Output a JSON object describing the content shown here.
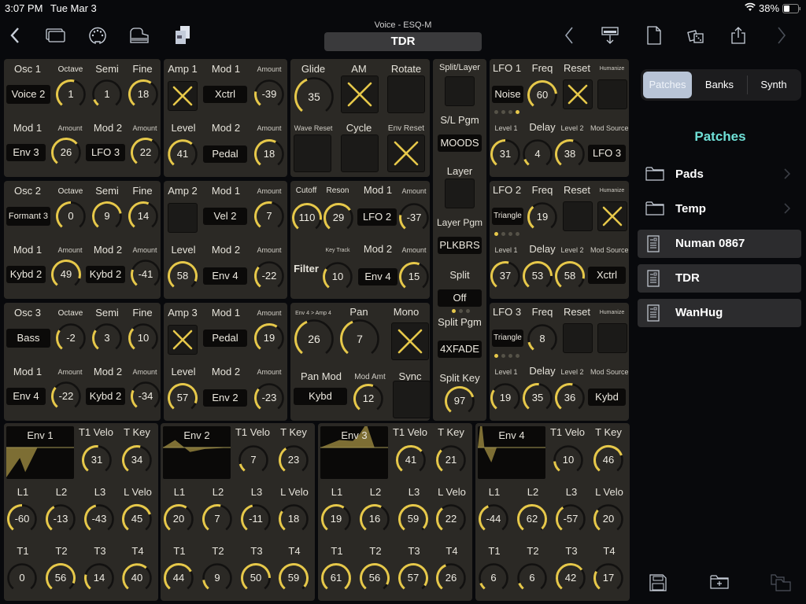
{
  "status": {
    "time": "3:07 PM",
    "date": "Tue Mar 3",
    "battery": "38%"
  },
  "toolbar": {
    "subtitle": "Voice - ESQ-M",
    "title": "TDR",
    "left_icons": [
      "back-chevron-icon",
      "windows-icon",
      "midi-din-icon",
      "piano-icon",
      "documents-icon"
    ],
    "right_icons": [
      "previous-chevron-icon",
      "keyboard-download-icon",
      "new-document-icon",
      "dice-random-icon",
      "share-icon",
      "next-chevron-icon"
    ]
  },
  "accent": "#e6c84a",
  "oscs": [
    {
      "name": "Osc 1",
      "wave": "Voice 2",
      "octave": "1",
      "semi": "1",
      "fine": "18",
      "mod1": "Env 3",
      "amt1": "26",
      "mod2": "LFO 3",
      "amt2": "22",
      "octave_f": 0.55,
      "semi_f": 0.1,
      "fine_f": 0.62,
      "amt1_f": 0.68,
      "amt2_f": 0.6
    },
    {
      "name": "Osc 2",
      "wave": "Formant 3",
      "octave": "0",
      "semi": "9",
      "fine": "14",
      "mod1": "Kybd 2",
      "amt1": "49",
      "mod2": "Kybd 2",
      "amt2": "-41",
      "octave_f": 0.5,
      "semi_f": 0.78,
      "fine_f": 0.58,
      "amt1_f": 0.88,
      "amt2_f": 0.25
    },
    {
      "name": "Osc 3",
      "wave": "Bass",
      "octave": "-2",
      "semi": "3",
      "fine": "10",
      "mod1": "Env 4",
      "amt1": "-22",
      "mod2": "Kybd 2",
      "amt2": "-34",
      "octave_f": 0.3,
      "semi_f": 0.3,
      "fine_f": 0.33,
      "amt1_f": 0.32,
      "amt2_f": 0.27
    }
  ],
  "amps": [
    {
      "name": "Amp 1",
      "on": true,
      "mod1": "Xctrl",
      "amt1": "-39",
      "level": "41",
      "mod2": "Pedal",
      "amt2": "18",
      "amt1_f": 0.22,
      "level_f": 0.65,
      "amt2_f": 0.6
    },
    {
      "name": "Amp 2",
      "on": false,
      "mod1": "Vel 2",
      "amt1": "7",
      "level": "58",
      "mod2": "Env 4",
      "amt2": "-22",
      "amt1_f": 0.54,
      "level_f": 0.9,
      "amt2_f": 0.32
    },
    {
      "name": "Amp 3",
      "on": true,
      "mod1": "Pedal",
      "amt1": "19",
      "level": "57",
      "mod2": "Env 2",
      "amt2": "-23",
      "amt1_f": 0.62,
      "level_f": 0.9,
      "amt2_f": 0.32
    }
  ],
  "labels": {
    "octave": "Octave",
    "semi": "Semi",
    "fine": "Fine",
    "mod1": "Mod 1",
    "mod2": "Mod 2",
    "amount": "Amount",
    "level": "Level",
    "glide": "Glide",
    "am": "AM",
    "rotate": "Rotate",
    "wave_reset": "Wave Reset",
    "cycle": "Cycle",
    "env_reset": "Env Reset",
    "cutoff": "Cutoff",
    "reson": "Reson",
    "key_track": "Key Track",
    "filter": "Filter",
    "env4amp4": "Env 4 > Amp 4",
    "pan": "Pan",
    "mono": "Mono",
    "pan_mod": "Pan Mod",
    "mod_amt": "Mod Amt",
    "sync": "Sync",
    "split_layer": "Split/Layer",
    "sl_pgm": "S/L Pgm",
    "layer": "Layer",
    "layer_pgm": "Layer Pgm",
    "split": "Split",
    "split_pgm": "Split Pgm",
    "split_key": "Split Key",
    "freq": "Freq",
    "reset": "Reset",
    "humanize": "Humanize",
    "level1": "Level 1",
    "delay": "Delay",
    "level2": "Level 2",
    "mod_source": "Mod Source",
    "t1velo": "T1 Velo",
    "tkey": "T Key",
    "l1": "L1",
    "l2": "L2",
    "l3": "L3",
    "lvelo": "L Velo",
    "t1": "T1",
    "t2": "T2",
    "t3": "T3",
    "t4": "T4"
  },
  "glide": {
    "glide": "35",
    "glide_f": 0.42,
    "am": true,
    "rotate": false,
    "wave_reset": false,
    "cycle": false,
    "env_reset": true
  },
  "filter": {
    "cutoff": "110",
    "reson": "29",
    "mod1": "LFO 2",
    "amt1": "-37",
    "key_track": "10",
    "mod2": "Env 4",
    "amt2": "15",
    "cutoff_f": 0.85,
    "reson_f": 0.7,
    "amt1_f": 0.22,
    "key_track_f": 0.3,
    "amt2_f": 0.58
  },
  "pan": {
    "env4amp4": "26",
    "pan": "7",
    "mono": true,
    "pan_mod": "Kybd",
    "mod_amt": "12",
    "sync": false,
    "env4amp4_f": 0.42,
    "pan_f": 0.42,
    "mod_amt_f": 0.57
  },
  "split_layer": {
    "split_layer": false,
    "sl_pgm": "MOODS",
    "layer": false,
    "layer_pgm": "PLKBRS",
    "split": "Off",
    "split_dots": [
      true,
      false,
      false
    ],
    "split_pgm": "4XFADE",
    "split_key": "97",
    "split_key_f": 0.76
  },
  "lfos": [
    {
      "name": "LFO 1",
      "wave": "Noise",
      "freq": "60",
      "reset": true,
      "humanize": false,
      "level1": "31",
      "delay": "4",
      "level2": "38",
      "mod_source": "LFO 3",
      "dots": [
        false,
        false,
        false,
        true
      ],
      "freq_f": 0.8,
      "level1_f": 0.5,
      "delay_f": 0.1,
      "level2_f": 0.55
    },
    {
      "name": "LFO 2",
      "wave": "Triangle",
      "freq": "19",
      "reset": false,
      "humanize": true,
      "level1": "37",
      "delay": "53",
      "level2": "58",
      "mod_source": "Xctrl",
      "dots": [
        true,
        false,
        false,
        false
      ],
      "freq_f": 0.35,
      "level1_f": 0.55,
      "delay_f": 0.82,
      "level2_f": 0.86
    },
    {
      "name": "LFO 3",
      "wave": "Triangle",
      "freq": "8",
      "reset": false,
      "humanize": false,
      "level1": "19",
      "delay": "35",
      "level2": "36",
      "mod_source": "Kybd",
      "dots": [
        true,
        false,
        false,
        false
      ],
      "freq_f": 0.13,
      "level1_f": 0.3,
      "delay_f": 0.52,
      "level2_f": 0.54
    }
  ],
  "envs": [
    {
      "name": "Env 1",
      "t1velo": "31",
      "tkey": "34",
      "l1": "-60",
      "l2": "-13",
      "l3": "-43",
      "lvelo": "45",
      "t1": "0",
      "t2": "56",
      "t3": "14",
      "t4": "40",
      "f": {
        "t1velo": 0.52,
        "tkey": 0.55,
        "l1": 0.5,
        "l2": 0.4,
        "l3": 0.45,
        "lvelo": 0.75,
        "t1": 0,
        "t2": 0.9,
        "t3": 0.23,
        "t4": 0.65
      },
      "shape": [
        [
          0,
          1
        ],
        [
          0.2,
          0.35
        ],
        [
          0.28,
          0.82
        ],
        [
          0.46,
          0
        ],
        [
          1,
          0
        ]
      ]
    },
    {
      "name": "Env 2",
      "t1velo": "7",
      "tkey": "23",
      "l1": "20",
      "l2": "7",
      "l3": "-11",
      "lvelo": "18",
      "t1": "44",
      "t2": "9",
      "t3": "50",
      "t4": "59",
      "f": {
        "t1velo": 0.12,
        "tkey": 0.38,
        "l1": 0.62,
        "l2": 0.55,
        "l3": 0.45,
        "lvelo": 0.3,
        "t1": 0.72,
        "t2": 0.15,
        "t3": 0.82,
        "t4": 0.96
      },
      "shape": [
        [
          0,
          0
        ],
        [
          0.18,
          -0.25
        ],
        [
          0.4,
          0.15
        ],
        [
          0.62,
          0.05
        ],
        [
          1,
          0
        ]
      ]
    },
    {
      "name": "Env 3",
      "t1velo": "41",
      "tkey": "21",
      "l1": "19",
      "l2": "16",
      "l3": "59",
      "lvelo": "22",
      "t1": "61",
      "t2": "56",
      "t3": "57",
      "t4": "26",
      "f": {
        "t1velo": 0.68,
        "tkey": 0.34,
        "l1": 0.62,
        "l2": 0.6,
        "l3": 0.97,
        "lvelo": 0.36,
        "t1": 1.0,
        "t2": 0.92,
        "t3": 0.94,
        "t4": 0.42
      },
      "shape": [
        [
          0,
          0
        ],
        [
          0.28,
          -0.25
        ],
        [
          0.48,
          -0.22
        ],
        [
          0.58,
          -0.45
        ],
        [
          0.68,
          -0.8
        ],
        [
          0.8,
          0
        ],
        [
          1,
          0
        ]
      ]
    },
    {
      "name": "Env 4",
      "t1velo": "10",
      "tkey": "46",
      "l1": "-44",
      "l2": "62",
      "l3": "-57",
      "lvelo": "20",
      "t1": "6",
      "t2": "6",
      "t3": "42",
      "t4": "17",
      "f": {
        "t1velo": 0.16,
        "tkey": 0.75,
        "l1": 0.42,
        "l2": 0.98,
        "l3": 0.38,
        "lvelo": 0.32,
        "t1": 0.1,
        "t2": 0.1,
        "t3": 0.69,
        "t4": 0.28
      },
      "shape": [
        [
          0,
          0.0
        ],
        [
          0.05,
          -1
        ],
        [
          0.1,
          0.05
        ],
        [
          0.2,
          0.5
        ],
        [
          0.28,
          0
        ],
        [
          1,
          0
        ]
      ]
    }
  ],
  "sidebar": {
    "tabs": [
      {
        "label": "Patches",
        "active": true
      },
      {
        "label": "Banks",
        "active": false
      },
      {
        "label": "Synth",
        "active": false
      }
    ],
    "title": "Patches",
    "folders": [
      {
        "name": "Pads"
      },
      {
        "name": "Temp"
      }
    ],
    "patches": [
      {
        "name": "Numan 0867"
      },
      {
        "name": "TDR"
      },
      {
        "name": "WanHug"
      }
    ],
    "bottom_icons": [
      "save-icon",
      "new-folder-icon",
      "move-folder-icon"
    ]
  }
}
